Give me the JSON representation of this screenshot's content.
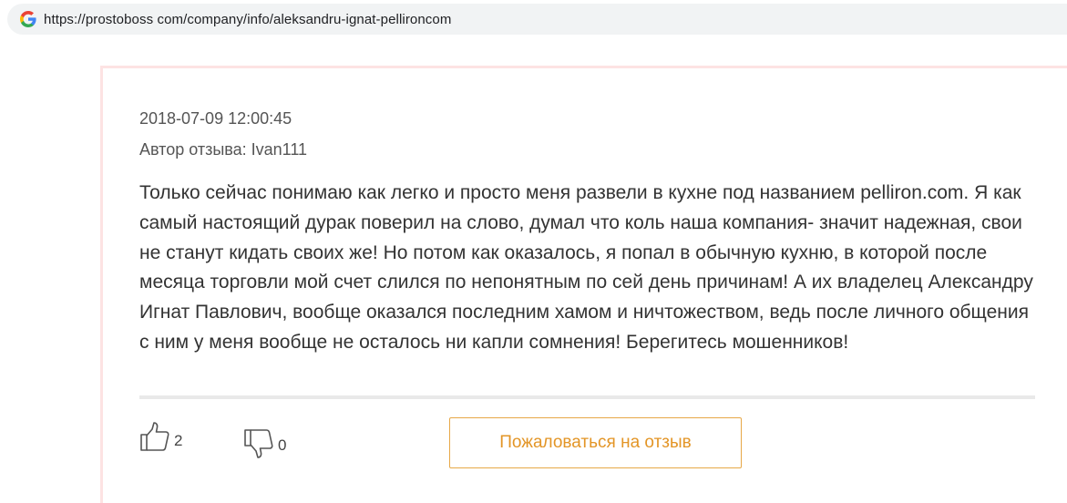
{
  "browser": {
    "url": "https://prostoboss com/company/info/aleksandru-ignat-pellironcom",
    "favicon": "google-g-icon"
  },
  "review": {
    "date": "2018-07-09 12:00:45",
    "author": "Автор отзыва: Ivan111",
    "text": "Только сейчас понимаю как легко и просто меня развели в кухне под названием pelliron.com. Я как самый настоящий дурак поверил на слово, думал что коль наша компания- значит надежная, свои не станут кидать своих же! Но потом как оказалось, я попал в обычную кухню, в которой после месяца торговли мой счет слился по непонятным по сей день причинам! А их владелец Александру Игнат Павлович, вообще оказался последним хамом и ничтожеством, ведь после личного общения с ним у меня вообще не осталось ни капли сомнения! Берегитесь мошенников!",
    "likes": "2",
    "dislikes": "0",
    "like_icon": "thumbs-up-icon",
    "dislike_icon": "thumbs-down-icon",
    "report_label": "Пожаловаться на отзыв"
  },
  "colors": {
    "accent": "#e39526",
    "card_border": "#fde3e3",
    "divider": "#e9e9e9"
  }
}
